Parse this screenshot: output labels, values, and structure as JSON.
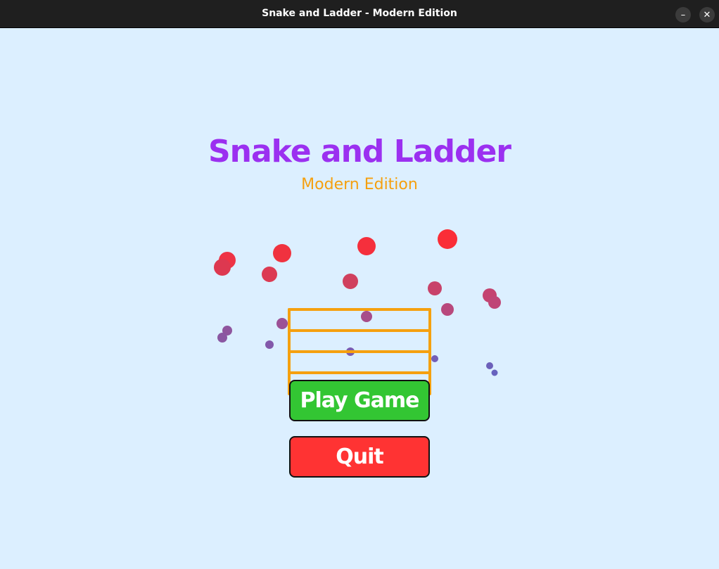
{
  "window": {
    "title": "Snake and Ladder - Modern Edition",
    "minimize_glyph": "–",
    "close_glyph": "✕"
  },
  "menu": {
    "title": "Snake and Ladder",
    "subtitle": "Modern Edition",
    "play_label": "Play Game",
    "quit_label": "Quit"
  },
  "colors": {
    "background": "#dcefff",
    "title": "#9b30f0",
    "subtitle": "#f5a00f",
    "ladder": "#f5a00f",
    "play_button": "#33c633",
    "quit_button": "#ff3333",
    "button_text": "#ffffff"
  },
  "decor": {
    "ladder": "ladder-graphic",
    "snake_dots": "snake-dot-cluster"
  }
}
